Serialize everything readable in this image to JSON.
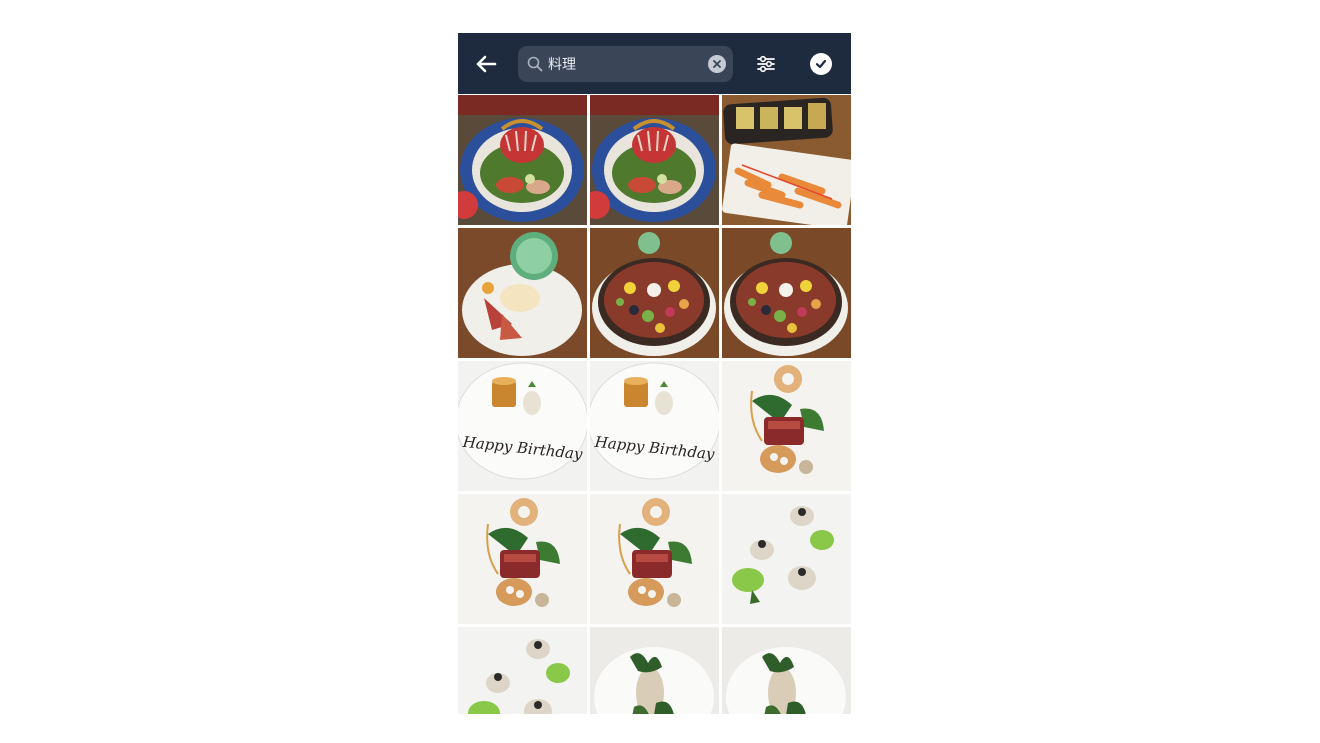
{
  "header": {
    "back_icon": "arrow-left-icon",
    "search": {
      "value": "料理",
      "placeholder": ""
    },
    "clear_icon": "clear-circle-icon",
    "filter_icon": "sliders-icon",
    "done_icon": "checkmark-circle-icon"
  },
  "colors": {
    "topbar": "#1e2a3e",
    "search_bg": "#3a4558"
  },
  "photos": [
    {
      "kind": "salad"
    },
    {
      "kind": "salad"
    },
    {
      "kind": "appetizers"
    },
    {
      "kind": "dessert-plate"
    },
    {
      "kind": "tart"
    },
    {
      "kind": "tart"
    },
    {
      "kind": "birthday",
      "plate_text": "Happy Birthday"
    },
    {
      "kind": "birthday",
      "plate_text": "Happy Birthday"
    },
    {
      "kind": "meat-dish"
    },
    {
      "kind": "meat-dish"
    },
    {
      "kind": "meat-dish"
    },
    {
      "kind": "scallop-dish"
    },
    {
      "kind": "scallop-dish"
    },
    {
      "kind": "herb-dish"
    },
    {
      "kind": "herb-dish"
    }
  ]
}
